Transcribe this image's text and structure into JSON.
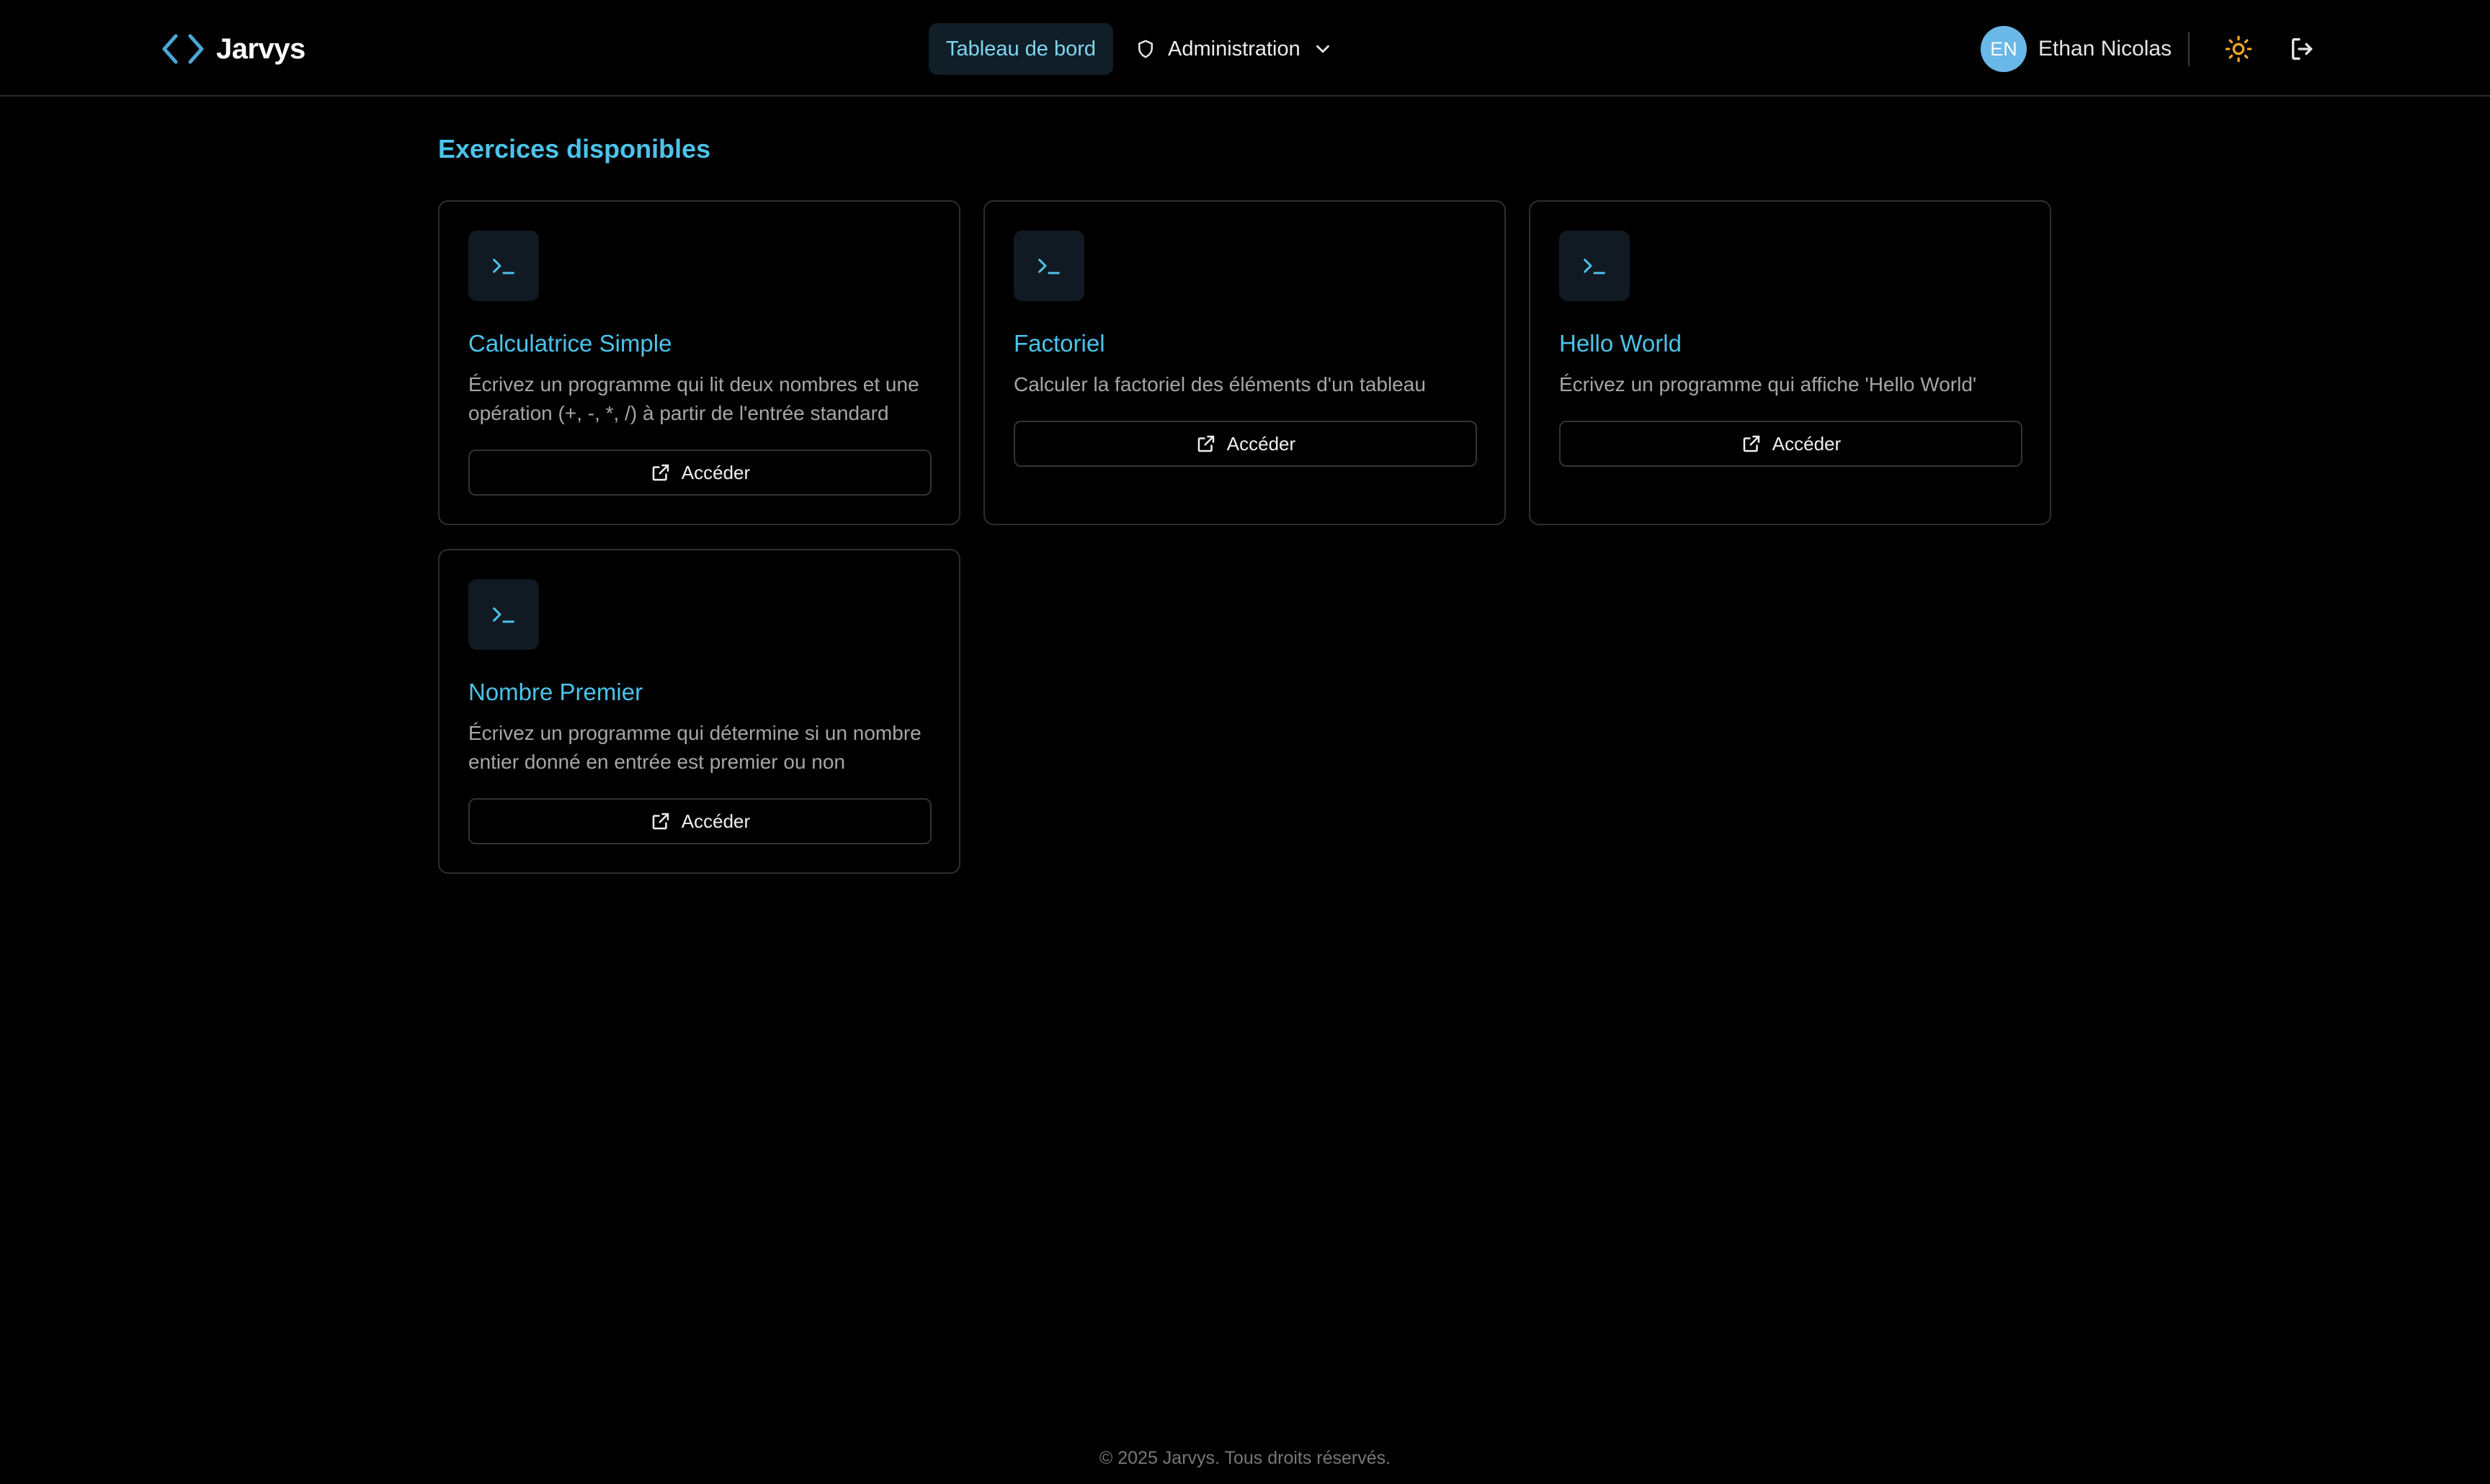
{
  "brand": {
    "name": "Jarvys",
    "logo_icon": "code-brackets-icon"
  },
  "nav": {
    "dashboard_label": "Tableau de bord",
    "admin_label": "Administration",
    "admin_icon": "shield-icon",
    "admin_chevron": "chevron-down-icon"
  },
  "user": {
    "initials": "EN",
    "name": "Ethan Nicolas"
  },
  "actions": {
    "theme_icon": "sun-icon",
    "logout_icon": "logout-icon"
  },
  "main": {
    "section_title": "Exercices disponibles",
    "exercises": [
      {
        "title": "Calculatrice Simple",
        "description": "Écrivez un programme qui lit deux nombres et une opération (+, -, *, /) à partir de l'entrée standard",
        "button_label": "Accéder",
        "icon": "terminal-icon"
      },
      {
        "title": "Factoriel",
        "description": "Calculer la factoriel des éléments d'un tableau",
        "button_label": "Accéder",
        "icon": "terminal-icon"
      },
      {
        "title": "Hello World",
        "description": "Écrivez un programme qui affiche 'Hello World'",
        "button_label": "Accéder",
        "icon": "terminal-icon"
      },
      {
        "title": "Nombre Premier",
        "description": "Écrivez un programme qui détermine si un nombre entier donné en entrée est premier ou non",
        "button_label": "Accéder",
        "icon": "terminal-icon"
      }
    ]
  },
  "footer": {
    "text": "© 2025 Jarvys. Tous droits réservés."
  },
  "colors": {
    "background": "#000000",
    "accent": "#4cc3ea",
    "active_tab_bg": "#0f1e27",
    "avatar_bg": "#69b8e8",
    "theme_icon": "#f5a623"
  }
}
